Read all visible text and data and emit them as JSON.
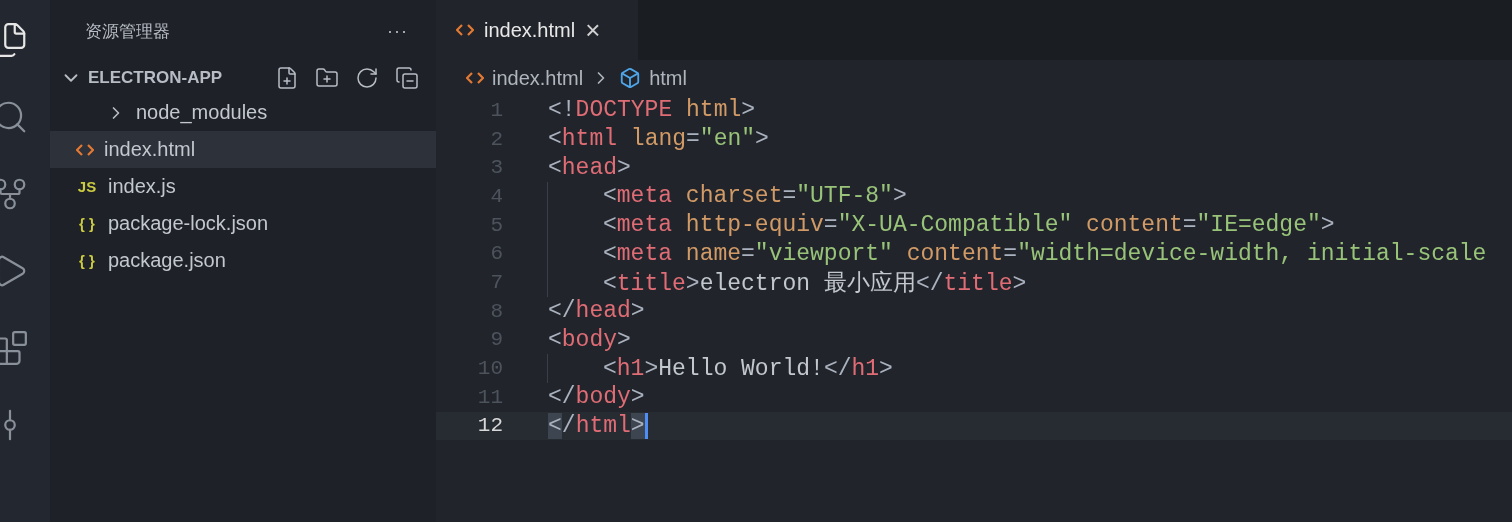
{
  "activity_bar": [
    {
      "kind": "files",
      "selected": true
    },
    {
      "kind": "search",
      "selected": false
    },
    {
      "kind": "source-control",
      "selected": false
    },
    {
      "kind": "run",
      "selected": false
    },
    {
      "kind": "extensions",
      "selected": false
    },
    {
      "kind": "git-graph",
      "selected": false
    }
  ],
  "sidebar": {
    "title": "资源管理器",
    "more": "···",
    "section": {
      "title": "ELECTRON-APP",
      "expanded": true
    },
    "items": [
      {
        "kind": "folder",
        "label": "node_modules",
        "expanded": false,
        "selected": false
      },
      {
        "kind": "html",
        "label": "index.html",
        "selected": true
      },
      {
        "kind": "js",
        "glyph": "JS",
        "label": "index.js",
        "selected": false
      },
      {
        "kind": "json",
        "glyph": "{ }",
        "label": "package-lock.json",
        "selected": false
      },
      {
        "kind": "json",
        "glyph": "{ }",
        "label": "package.json",
        "selected": false
      }
    ]
  },
  "tabs": [
    {
      "label": "index.html",
      "selected": true,
      "close": "×"
    }
  ],
  "breadcrumb": [
    {
      "kind": "html",
      "label": "index.html"
    },
    {
      "kind": "element",
      "label": "html"
    }
  ],
  "editor": {
    "lines": [
      {
        "number": "1",
        "indented": false,
        "current": false,
        "tokens": [
          {
            "kind": "punct",
            "text": "<!"
          },
          {
            "kind": "tag",
            "text": "DOCTYPE"
          },
          {
            "kind": "attr",
            "text": " html"
          },
          {
            "kind": "punct",
            "text": ">"
          }
        ]
      },
      {
        "number": "2",
        "indented": false,
        "current": false,
        "tokens": [
          {
            "kind": "punct",
            "text": "<"
          },
          {
            "kind": "tag",
            "text": "html"
          },
          {
            "kind": "attr",
            "text": " lang"
          },
          {
            "kind": "punct",
            "text": "="
          },
          {
            "kind": "string",
            "text": "\"en\""
          },
          {
            "kind": "punct",
            "text": ">"
          }
        ]
      },
      {
        "number": "3",
        "indented": false,
        "current": false,
        "tokens": [
          {
            "kind": "punct",
            "text": "<"
          },
          {
            "kind": "tag",
            "text": "head"
          },
          {
            "kind": "punct",
            "text": ">"
          }
        ]
      },
      {
        "number": "4",
        "indented": true,
        "current": false,
        "tokens": [
          {
            "kind": "punct",
            "text": "<"
          },
          {
            "kind": "tag",
            "text": "meta"
          },
          {
            "kind": "attr",
            "text": " charset"
          },
          {
            "kind": "punct",
            "text": "="
          },
          {
            "kind": "string",
            "text": "\"UTF-8\""
          },
          {
            "kind": "punct",
            "text": ">"
          }
        ]
      },
      {
        "number": "5",
        "indented": true,
        "current": false,
        "tokens": [
          {
            "kind": "punct",
            "text": "<"
          },
          {
            "kind": "tag",
            "text": "meta"
          },
          {
            "kind": "attr",
            "text": " http-equiv"
          },
          {
            "kind": "punct",
            "text": "="
          },
          {
            "kind": "string",
            "text": "\"X-UA-Compatible\""
          },
          {
            "kind": "attr",
            "text": " content"
          },
          {
            "kind": "punct",
            "text": "="
          },
          {
            "kind": "string",
            "text": "\"IE=edge\""
          },
          {
            "kind": "punct",
            "text": ">"
          }
        ]
      },
      {
        "number": "6",
        "indented": true,
        "current": false,
        "tokens": [
          {
            "kind": "punct",
            "text": "<"
          },
          {
            "kind": "tag",
            "text": "meta"
          },
          {
            "kind": "attr",
            "text": " name"
          },
          {
            "kind": "punct",
            "text": "="
          },
          {
            "kind": "string",
            "text": "\"viewport\""
          },
          {
            "kind": "attr",
            "text": " content"
          },
          {
            "kind": "punct",
            "text": "="
          },
          {
            "kind": "string",
            "text": "\"width=device-width, initial-scale"
          }
        ]
      },
      {
        "number": "7",
        "indented": true,
        "current": false,
        "tokens": [
          {
            "kind": "punct",
            "text": "<"
          },
          {
            "kind": "tag",
            "text": "title"
          },
          {
            "kind": "punct",
            "text": ">"
          },
          {
            "kind": "text",
            "text": "electron 最小应用"
          },
          {
            "kind": "punct",
            "text": "</"
          },
          {
            "kind": "tag",
            "text": "title"
          },
          {
            "kind": "punct",
            "text": ">"
          }
        ]
      },
      {
        "number": "8",
        "indented": false,
        "current": false,
        "tokens": [
          {
            "kind": "punct",
            "text": "</"
          },
          {
            "kind": "tag",
            "text": "head"
          },
          {
            "kind": "punct",
            "text": ">"
          }
        ]
      },
      {
        "number": "9",
        "indented": false,
        "current": false,
        "tokens": [
          {
            "kind": "punct",
            "text": "<"
          },
          {
            "kind": "tag",
            "text": "body"
          },
          {
            "kind": "punct",
            "text": ">"
          }
        ]
      },
      {
        "number": "10",
        "indented": true,
        "current": false,
        "tokens": [
          {
            "kind": "punct",
            "text": "<"
          },
          {
            "kind": "tag",
            "text": "h1"
          },
          {
            "kind": "punct",
            "text": ">"
          },
          {
            "kind": "text",
            "text": "Hello World!"
          },
          {
            "kind": "punct",
            "text": "</"
          },
          {
            "kind": "tag",
            "text": "h1"
          },
          {
            "kind": "punct",
            "text": ">"
          }
        ]
      },
      {
        "number": "11",
        "indented": false,
        "current": false,
        "tokens": [
          {
            "kind": "punct",
            "text": "</"
          },
          {
            "kind": "tag",
            "text": "body"
          },
          {
            "kind": "punct",
            "text": ">"
          }
        ]
      },
      {
        "number": "12",
        "indented": false,
        "current": true,
        "cursor": true,
        "tokens": [
          {
            "kind": "bracket",
            "text": "<"
          },
          {
            "kind": "punct",
            "text": "/"
          },
          {
            "kind": "tag",
            "text": "html"
          },
          {
            "kind": "bracket",
            "text": ">"
          }
        ]
      }
    ]
  }
}
